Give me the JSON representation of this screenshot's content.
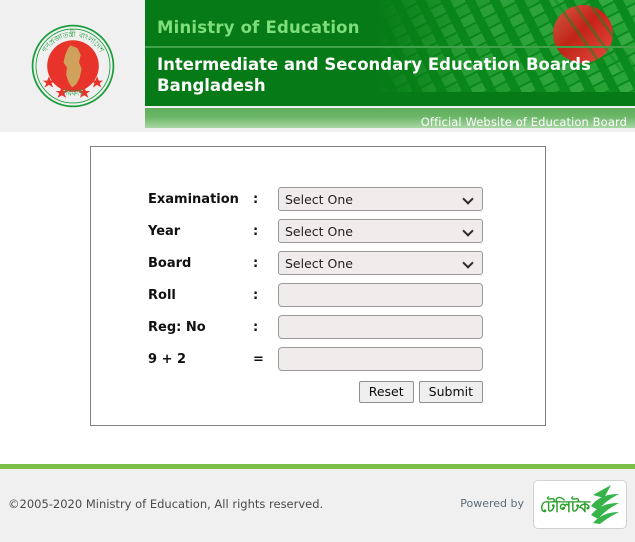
{
  "header": {
    "ministry_line": "Ministry of Education",
    "board_title": "Intermediate and Secondary Education Boards Bangladesh",
    "tagline": "Official Website of Education Board",
    "seal_alt": "government-seal-bangladesh",
    "colors": {
      "dark_green": "#067a16",
      "light_green_text": "#7ede7a",
      "tagline_green": "#6cb668",
      "logo_panel_bg": "#f0f0f0",
      "flag_red": "#e01b24"
    }
  },
  "form": {
    "rows": [
      {
        "label": "Examination",
        "separator": ":",
        "type": "select",
        "value": "Select One"
      },
      {
        "label": "Year",
        "separator": ":",
        "type": "select",
        "value": "Select One"
      },
      {
        "label": "Board",
        "separator": ":",
        "type": "select",
        "value": "Select One"
      },
      {
        "label": "Roll",
        "separator": ":",
        "type": "input",
        "value": "",
        "placeholder": ""
      },
      {
        "label": "Reg: No",
        "separator": ":",
        "type": "input",
        "value": "",
        "placeholder": ""
      },
      {
        "label": "9 + 2",
        "separator": "=",
        "type": "input",
        "value": "",
        "placeholder": ""
      }
    ],
    "buttons": {
      "reset_label": "Reset",
      "submit_label": "Submit"
    }
  },
  "footer": {
    "copyright": "©2005-2020 Ministry of Education, All rights reserved.",
    "powered_by": "Powered by",
    "partner_logo_text": "টেলিটক",
    "partner_logo_name": "teletalk-logo",
    "separator_color": "#7cc04a",
    "background": "#f0f0f0"
  }
}
